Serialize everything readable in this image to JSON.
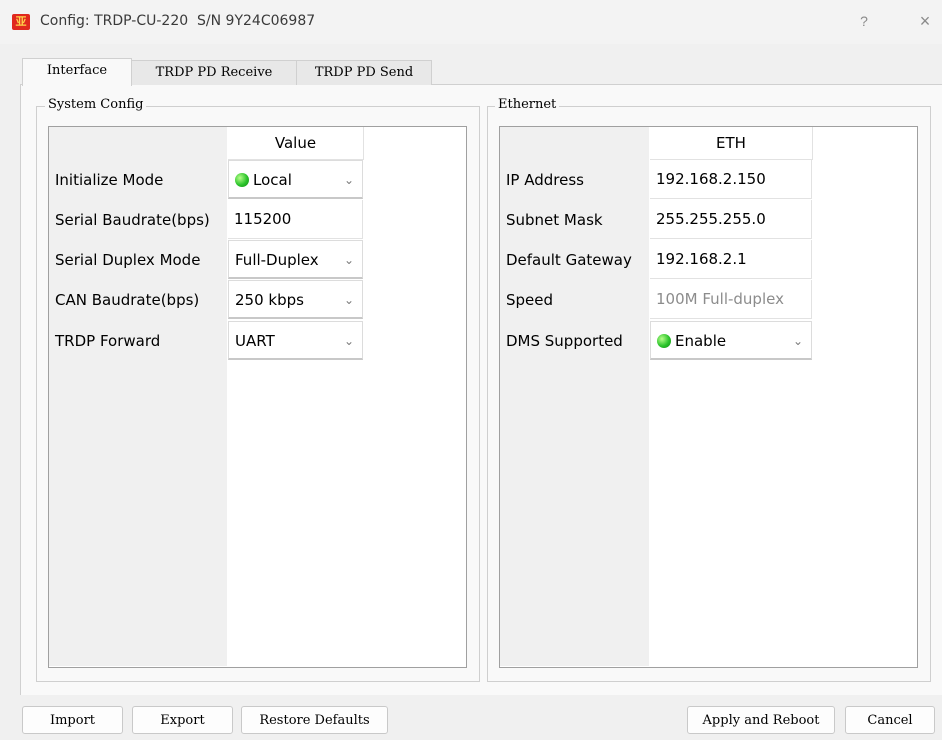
{
  "window": {
    "title": "Config: TRDP-CU-220  S/N 9Y24C06987",
    "icon_char": "亚",
    "help_glyph": "?",
    "close_glyph": "×"
  },
  "tabs": [
    {
      "label": "Interface",
      "active": true
    },
    {
      "label": "TRDP PD Receive",
      "active": false
    },
    {
      "label": "TRDP PD Send",
      "active": false
    }
  ],
  "system_config": {
    "title": "System Config",
    "column_header": "Value",
    "rows": [
      {
        "label": "Initialize Mode",
        "value": "Local",
        "type": "combo",
        "led": true
      },
      {
        "label": "Serial Baudrate(bps)",
        "value": "115200",
        "type": "text"
      },
      {
        "label": "Serial Duplex Mode",
        "value": "Full-Duplex",
        "type": "combo"
      },
      {
        "label": "CAN Baudrate(bps)",
        "value": "250 kbps",
        "type": "combo"
      },
      {
        "label": "TRDP Forward",
        "value": "UART",
        "type": "combo"
      }
    ]
  },
  "ethernet": {
    "title": "Ethernet",
    "column_header": "ETH",
    "rows": [
      {
        "label": "IP Address",
        "value": "192.168.2.150",
        "type": "text"
      },
      {
        "label": "Subnet Mask",
        "value": "255.255.255.0",
        "type": "text"
      },
      {
        "label": "Default Gateway",
        "value": "192.168.2.1",
        "type": "text"
      },
      {
        "label": "Speed",
        "value": "100M Full-duplex",
        "type": "readonly"
      },
      {
        "label": "DMS Supported",
        "value": "Enable",
        "type": "combo",
        "led": true
      }
    ]
  },
  "buttons": {
    "import": "Import",
    "export": "Export",
    "restore_defaults": "Restore Defaults",
    "apply_reboot": "Apply and Reboot",
    "cancel": "Cancel"
  },
  "icons": {
    "chevron": "chevron-down-icon",
    "led": "green-led-icon",
    "app": "app-logo-icon"
  },
  "colors": {
    "led_green": "#2bc32b",
    "app_icon": "#e0281e"
  }
}
